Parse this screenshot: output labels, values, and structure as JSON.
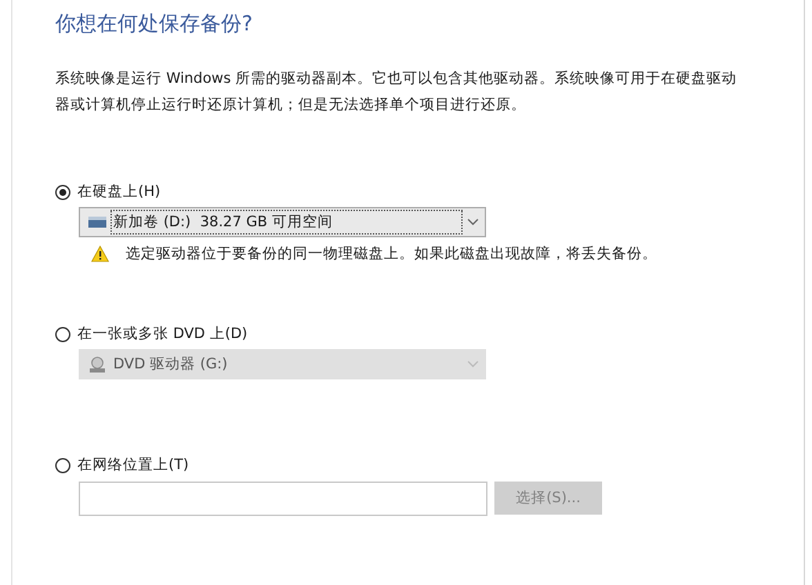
{
  "heading": "你想在何处保存备份?",
  "description": "系统映像是运行 Windows 所需的驱动器副本。它也可以包含其他驱动器。系统映像可用于在硬盘驱动器或计算机停止运行时还原计算机；但是无法选择单个项目进行还原。",
  "options": [
    {
      "kind": "drive",
      "label": "在硬盘上(H)",
      "selected": true,
      "dropdown": {
        "value": "新加卷 (D:)  38.27 GB 可用空间",
        "disabled": false
      },
      "warning": "选定驱动器位于要备份的同一物理磁盘上。如果此磁盘出现故障，将丢失备份。"
    },
    {
      "kind": "dvd",
      "label": "在一张或多张 DVD 上(D)",
      "selected": false,
      "dropdown": {
        "value": "DVD 驱动器 (G:)",
        "disabled": true
      }
    },
    {
      "kind": "network",
      "label": "在网络位置上(T)",
      "selected": false,
      "field": {
        "disabled": false
      },
      "button": {
        "label": "选择(S)...",
        "disabled": true
      }
    }
  ]
}
